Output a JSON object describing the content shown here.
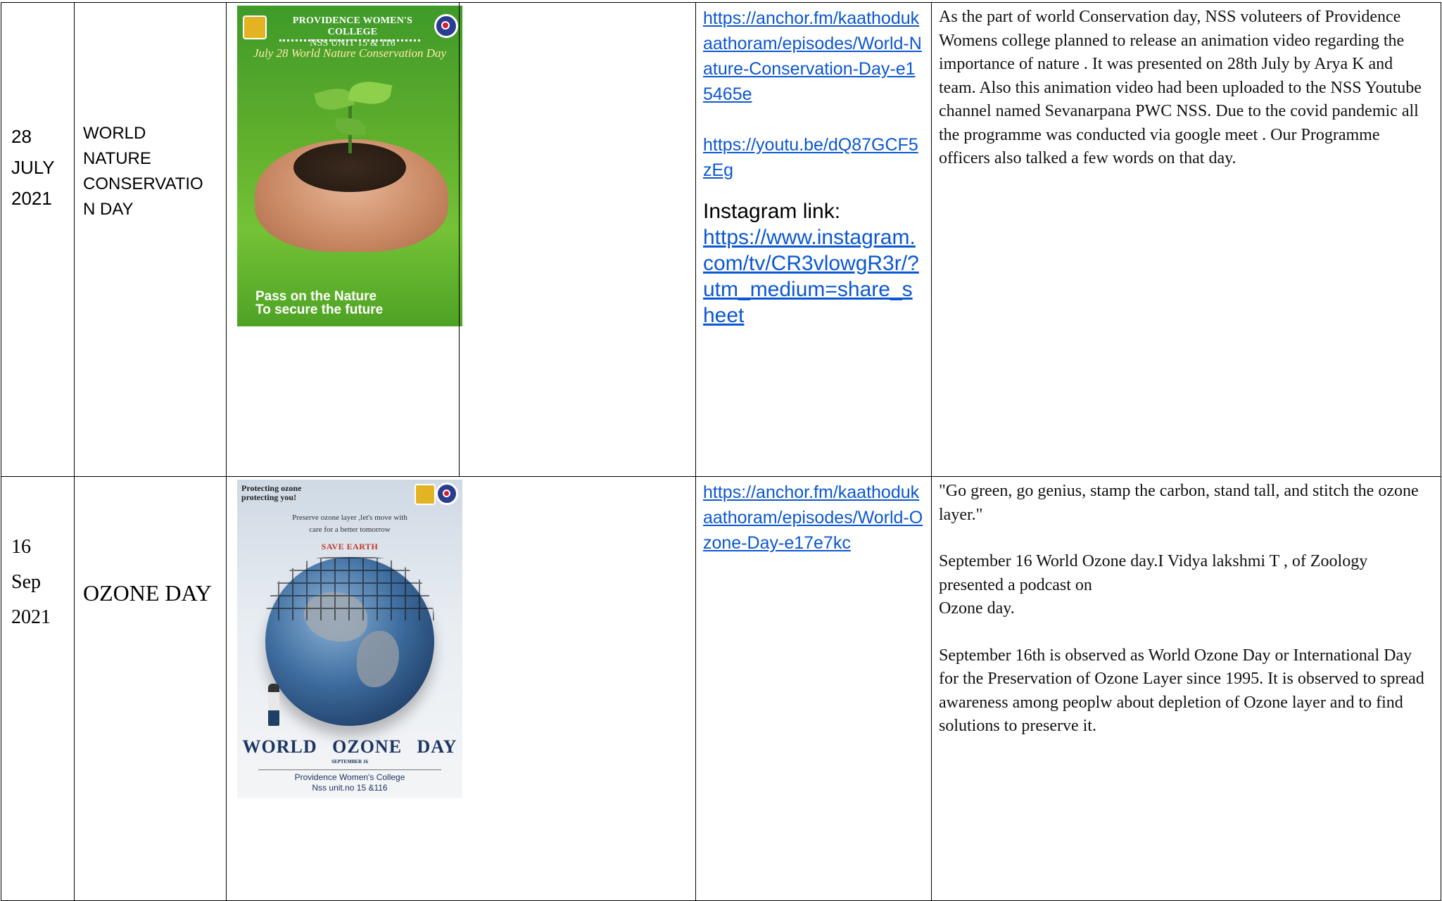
{
  "rows": [
    {
      "date": [
        "28",
        "JULY",
        "2021"
      ],
      "programme_lines": [
        "WORLD",
        "NATURE",
        "CONSERVATIO",
        "N DAY"
      ],
      "poster": {
        "header_line1": "PROVIDENCE WOMEN'S COLLEGE",
        "header_line2": "NSS UNIT 15 & 116",
        "subtitle": "July 28 World Nature Conservation Day",
        "footer_line1": "Pass on the Nature",
        "footer_line2": "To secure the future"
      },
      "links": {
        "anchor_url": "https://anchor.fm/kaathodukaathoram/episodes/World-Nature-Conservation-Day-e15465e",
        "youtube_url": "https://youtu.be/dQ87GCF5zEg",
        "instagram_label": "Instagram link:",
        "instagram_url": "https://www.instagram.com/tv/CR3vlowgR3r/?utm_medium=share_sheet"
      },
      "description": "As the part of world Conservation day, NSS voluteers of Providence Womens college planned to release an animation video regarding the importance of nature . It was presented on 28th July by Arya K and team. Also this animation video had been uploaded to the NSS Youtube channel named Sevanarpana PWC NSS. Due to the covid pandemic all the programme was conducted via google meet . Our Programme officers also talked a few words on that day."
    },
    {
      "date": [
        "16",
        "Sep",
        "2021"
      ],
      "programme": "OZONE DAY",
      "poster": {
        "top_left_line1": "Protecting ozone",
        "top_left_line2": "protecting you!",
        "tagline_line1": "Preserve ozone layer ,let's move with",
        "tagline_line2": "care for a  better tomorrow",
        "save": "SAVE EARTH",
        "title": "WORLD OZONE DAY",
        "date": "SEPTEMBER 16",
        "footer_line1": "Providence Women's College",
        "footer_line2": "Nss unit.no 15 &116"
      },
      "links": {
        "anchor_url": "https://anchor.fm/kaathodukaathoram/episodes/World-Ozone-Day-e17e7kc"
      },
      "description": {
        "quote": "\"Go green, go genius, stamp the carbon, stand tall, and stitch the ozone layer.\"",
        "para1_line1": "September 16 World Ozone day.I Vidya lakshmi T , of Zoology presented a podcast on",
        "para1_line2": "Ozone day.",
        "para2": "September 16th is observed as World Ozone Day or International Day for the Preservation of Ozone Layer since 1995. It is observed to spread awareness among peoplw about depletion of Ozone layer and to find solutions to preserve it."
      }
    }
  ]
}
